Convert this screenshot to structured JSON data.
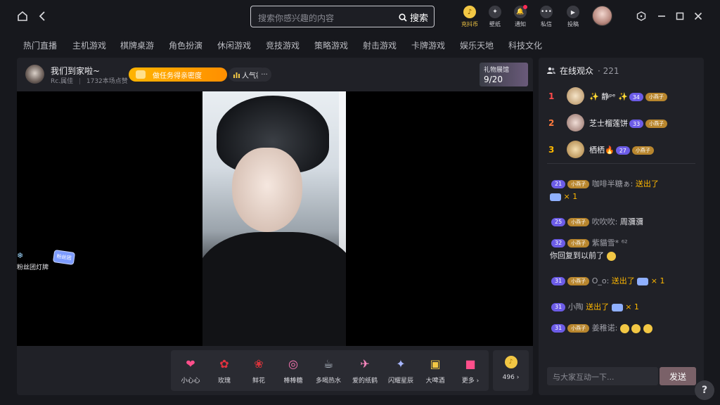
{
  "search": {
    "placeholder": "搜索你感兴趣的内容",
    "button_label": "搜索"
  },
  "toolbar": [
    {
      "label": "充抖币",
      "icon": "coin-icon",
      "color": "#f2c744"
    },
    {
      "label": "壁纸",
      "icon": "wallpaper-icon"
    },
    {
      "label": "通知",
      "icon": "bell-icon"
    },
    {
      "label": "私信",
      "icon": "message-icon"
    },
    {
      "label": "投稿",
      "icon": "upload-icon"
    }
  ],
  "categories": [
    "热门直播",
    "主机游戏",
    "棋牌桌游",
    "角色扮演",
    "休闲游戏",
    "竞技游戏",
    "策略游戏",
    "射击游戏",
    "卡牌游戏",
    "娱乐天地",
    "科技文化"
  ],
  "streamer": {
    "name": "我们到家啦~",
    "handle": "Rc.属佳",
    "likes": "1732本场点赞",
    "task_label": "做任务得亲密度",
    "popularity_label": "人气榜",
    "more_label": "···"
  },
  "gift_hall": {
    "title": "礼物展馆",
    "progress": "9/20"
  },
  "fan_badge": {
    "label": "粉丝团灯牌",
    "tag": "粉丝团"
  },
  "gifts": [
    {
      "label": "小心心",
      "icon": "heart-icon",
      "glyph": "❤",
      "color": "#ff4f8b"
    },
    {
      "label": "玫瑰",
      "icon": "rose-icon",
      "glyph": "🌹",
      "color": "#e3323f"
    },
    {
      "label": "鲜花",
      "icon": "bouquet-icon",
      "glyph": "💐",
      "color": "#d8343b"
    },
    {
      "label": "棒棒糖",
      "icon": "lollipop-icon",
      "glyph": "🍭",
      "color": "#ff77b7"
    },
    {
      "label": "多喝热水",
      "icon": "cup-icon",
      "glyph": "🥤",
      "color": "#b9c3cf"
    },
    {
      "label": "爱的纸鹤",
      "icon": "paper-crane-icon",
      "glyph": "✈",
      "color": "#ff89c2"
    },
    {
      "label": "闪耀星辰",
      "icon": "star-icon",
      "glyph": "✦",
      "color": "#a7b6ff"
    },
    {
      "label": "大啤酒",
      "icon": "beer-icon",
      "glyph": "🍺",
      "color": "#f2c744"
    },
    {
      "label": "更多 ›",
      "icon": "gift-box-icon",
      "glyph": "🎁",
      "color": "#ff4f8b"
    }
  ],
  "balance": "496 ›",
  "audience": {
    "title": "在线观众",
    "count": "· 221",
    "ranks": [
      {
        "rank": "1",
        "name": "✨ 静ᵖᵉ ✨",
        "level": "34",
        "fan": "小燕子",
        "color": "#ff4a4a"
      },
      {
        "rank": "2",
        "name": "芝士榴莲饼",
        "level": "33",
        "fan": "小燕子",
        "color": "#ff7a3d"
      },
      {
        "rank": "3",
        "name": "栖栖🔥",
        "level": "27",
        "fan": "小燕子",
        "color": "#ffb800"
      }
    ]
  },
  "chat": [
    {
      "level": "21",
      "fan": "小燕子",
      "user": "咖啡半糖ぁ:",
      "text": "送出了",
      "extra": "× 1"
    },
    {
      "level": "25",
      "fan": "小燕子",
      "user": "吹吹吹:",
      "text": "周瀰瀰"
    },
    {
      "level": "32",
      "fan": "小燕子",
      "user": "紫貓雪*",
      "text": "你回复到以前了",
      "prefix": "⁶²"
    },
    {
      "level": "31",
      "fan": "小燕子",
      "user": "O_o:",
      "text": "送出了",
      "extra": "× 1"
    },
    {
      "level": "31",
      "user": "小陶",
      "text": "送出了",
      "extra": "× 1"
    },
    {
      "level": "31",
      "fan": "小燕子",
      "user": "姜稚诺:",
      "text": ""
    }
  ],
  "input": {
    "placeholder": "与大家互动一下...",
    "send_label": "发送"
  },
  "help_label": "?"
}
